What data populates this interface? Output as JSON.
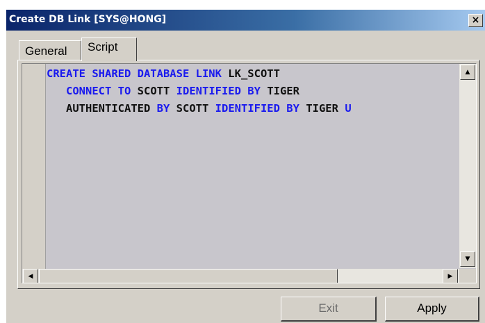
{
  "window": {
    "title": "Create DB Link [SYS@HONG]",
    "close_label": "×"
  },
  "tabs": [
    {
      "label": "General",
      "active": false
    },
    {
      "label": "Script",
      "active": true
    }
  ],
  "script": {
    "lines": [
      [
        {
          "text": "CREATE SHARED DATABASE LINK ",
          "type": "keyword"
        },
        {
          "text": "LK_SCOTT",
          "type": "identifier"
        }
      ],
      [
        {
          "text": "   ",
          "type": "identifier"
        },
        {
          "text": "CONNECT TO ",
          "type": "keyword"
        },
        {
          "text": "SCOTT ",
          "type": "identifier"
        },
        {
          "text": "IDENTIFIED BY ",
          "type": "keyword"
        },
        {
          "text": "TIGER",
          "type": "identifier"
        }
      ],
      [
        {
          "text": "   ",
          "type": "identifier"
        },
        {
          "text": "AUTHENTICATED ",
          "type": "identifier"
        },
        {
          "text": "BY ",
          "type": "keyword"
        },
        {
          "text": "SCOTT ",
          "type": "identifier"
        },
        {
          "text": "IDENTIFIED BY ",
          "type": "keyword"
        },
        {
          "text": "TIGER ",
          "type": "identifier"
        },
        {
          "text": "U",
          "type": "keyword"
        }
      ]
    ]
  },
  "scrollbars": {
    "up_arrow": "▲",
    "down_arrow": "▼",
    "left_arrow": "◀",
    "right_arrow": "▶"
  },
  "buttons": {
    "exit_label": "Exit",
    "apply_label": "Apply"
  },
  "colors": {
    "keyword": "#1a1aee",
    "identifier": "#101010",
    "editor_bg": "#c8c6cc",
    "titlebar_start": "#0a246a",
    "titlebar_end": "#a6caf0"
  }
}
